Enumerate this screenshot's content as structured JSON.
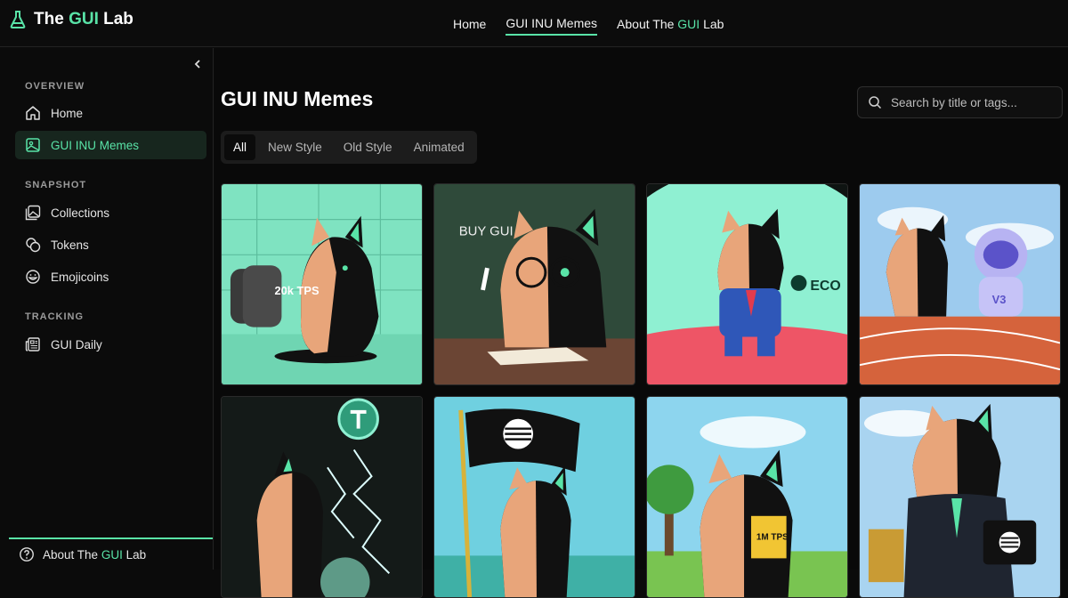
{
  "app": {
    "brand_prefix": "The ",
    "brand_accent": "GUI",
    "brand_suffix": " Lab",
    "accent_color": "#59e3a7"
  },
  "topnav": {
    "items": [
      {
        "label": "Home"
      },
      {
        "label": "GUI INU Memes",
        "active": true
      }
    ],
    "about_prefix": "About The ",
    "about_accent": "GUI",
    "about_suffix": " Lab"
  },
  "sidebar": {
    "overview_label": "OVERVIEW",
    "snapshot_label": "SNAPSHOT",
    "tracking_label": "TRACKING",
    "items": [
      {
        "label": "Home",
        "icon": "home-icon"
      },
      {
        "label": "GUI INU Memes",
        "icon": "image-icon",
        "active": true
      },
      {
        "label": "Collections",
        "icon": "collection-icon"
      },
      {
        "label": "Tokens",
        "icon": "coins-icon"
      },
      {
        "label": "Emojicoins",
        "icon": "smiley-icon"
      },
      {
        "label": "GUI Daily",
        "icon": "newspaper-icon"
      }
    ],
    "footer_prefix": "About The ",
    "footer_accent": "GUI",
    "footer_suffix": " Lab"
  },
  "main": {
    "title": "GUI INU Memes",
    "search_placeholder": "Search by title or tags...",
    "tabs": [
      {
        "label": "All",
        "active": true
      },
      {
        "label": "New Style"
      },
      {
        "label": "Old Style"
      },
      {
        "label": "Animated"
      }
    ]
  },
  "memes": [
    {
      "caption": "20k TPS"
    },
    {
      "caption": "BUY GUI"
    },
    {
      "caption": "ECO"
    },
    {
      "caption": "V3"
    },
    {
      "caption": ""
    },
    {
      "caption": ""
    },
    {
      "caption": "1M TPS"
    },
    {
      "caption": ""
    }
  ]
}
